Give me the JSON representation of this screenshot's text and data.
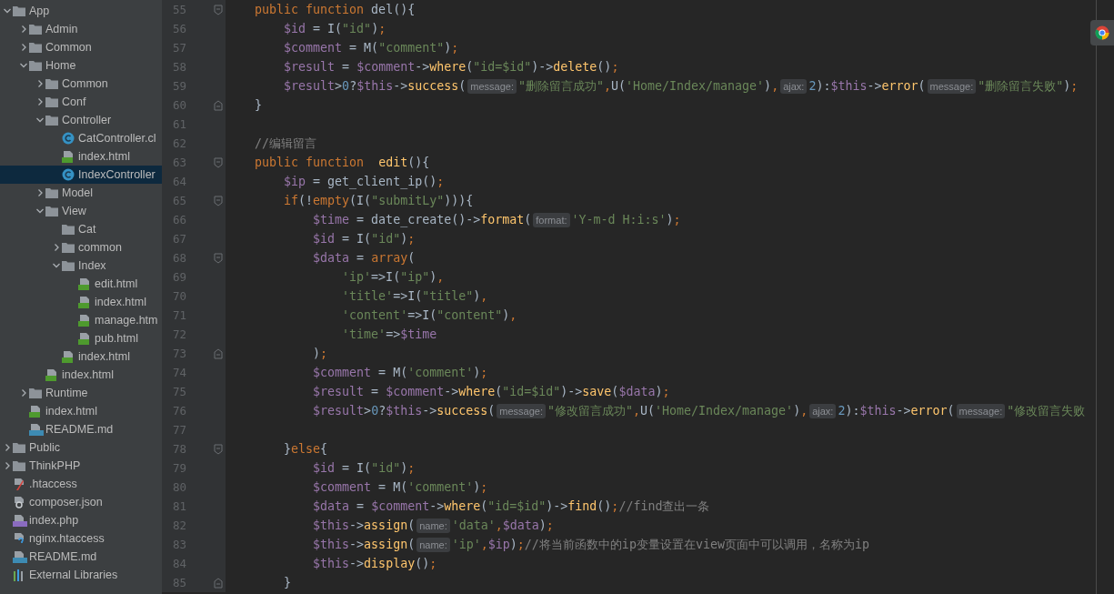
{
  "project_tree": {
    "items": [
      {
        "name": "App",
        "kind": "folder",
        "expanded": true,
        "selected": false,
        "children": [
          {
            "name": "Admin",
            "kind": "folder",
            "expanded": false,
            "selected": false
          },
          {
            "name": "Common",
            "kind": "folder",
            "expanded": false,
            "selected": false
          },
          {
            "name": "Home",
            "kind": "folder",
            "expanded": true,
            "selected": false,
            "children": [
              {
                "name": "Common",
                "kind": "folder",
                "expanded": false,
                "selected": false
              },
              {
                "name": "Conf",
                "kind": "folder",
                "expanded": false,
                "selected": false
              },
              {
                "name": "Controller",
                "kind": "folder",
                "expanded": true,
                "selected": false,
                "children": [
                  {
                    "name": "CatController.cl",
                    "kind": "class",
                    "selected": false
                  },
                  {
                    "name": "index.html",
                    "kind": "html",
                    "selected": false
                  },
                  {
                    "name": "IndexController",
                    "kind": "class",
                    "selected": true
                  }
                ]
              },
              {
                "name": "Model",
                "kind": "folder",
                "expanded": false,
                "selected": false
              },
              {
                "name": "View",
                "kind": "folder",
                "expanded": true,
                "selected": false,
                "children": [
                  {
                    "name": "Cat",
                    "kind": "folder",
                    "selected": false
                  },
                  {
                    "name": "common",
                    "kind": "folder",
                    "expanded": false,
                    "selected": false
                  },
                  {
                    "name": "Index",
                    "kind": "folder",
                    "expanded": true,
                    "selected": false,
                    "children": [
                      {
                        "name": "edit.html",
                        "kind": "html",
                        "selected": false
                      },
                      {
                        "name": "index.html",
                        "kind": "html",
                        "selected": false
                      },
                      {
                        "name": "manage.htm",
                        "kind": "html",
                        "selected": false
                      },
                      {
                        "name": "pub.html",
                        "kind": "html",
                        "selected": false
                      }
                    ]
                  },
                  {
                    "name": "index.html",
                    "kind": "html",
                    "selected": false
                  }
                ]
              },
              {
                "name": "index.html",
                "kind": "html",
                "selected": false
              }
            ]
          },
          {
            "name": "Runtime",
            "kind": "folder",
            "expanded": false,
            "selected": false
          },
          {
            "name": "index.html",
            "kind": "html",
            "selected": false
          },
          {
            "name": "README.md",
            "kind": "md",
            "selected": false
          }
        ]
      },
      {
        "name": "Public",
        "kind": "folder",
        "expanded": false,
        "selected": false
      },
      {
        "name": "ThinkPHP",
        "kind": "folder",
        "expanded": false,
        "selected": false
      },
      {
        "name": ".htaccess",
        "kind": "htaccess",
        "selected": false
      },
      {
        "name": "composer.json",
        "kind": "json",
        "selected": false
      },
      {
        "name": "index.php",
        "kind": "php",
        "selected": false
      },
      {
        "name": "nginx.htaccess",
        "kind": "nginx",
        "selected": false
      },
      {
        "name": "README.md",
        "kind": "md",
        "selected": false
      },
      {
        "name": "External Libraries",
        "kind": "libraries",
        "selected": false
      }
    ]
  },
  "editor": {
    "lines": [
      {
        "number": "55",
        "fold_start": true,
        "tokens": [
          {
            "kind": "keyword",
            "text": "    public function"
          },
          {
            "kind": "plain",
            "text": " del(){"
          }
        ]
      },
      {
        "number": "56",
        "tokens": [
          {
            "kind": "variable",
            "text": "        $id"
          },
          {
            "kind": "plain",
            "text": " = I("
          },
          {
            "kind": "string",
            "text": "\"id\""
          },
          {
            "kind": "plain",
            "text": ")"
          },
          {
            "kind": "punct",
            "text": ";"
          }
        ]
      },
      {
        "number": "57",
        "tokens": [
          {
            "kind": "variable",
            "text": "        $comment"
          },
          {
            "kind": "plain",
            "text": " = M("
          },
          {
            "kind": "string",
            "text": "\"comment\""
          },
          {
            "kind": "plain",
            "text": ")"
          },
          {
            "kind": "punct",
            "text": ";"
          }
        ]
      },
      {
        "number": "58",
        "tokens": [
          {
            "kind": "variable",
            "text": "        $result"
          },
          {
            "kind": "plain",
            "text": " = "
          },
          {
            "kind": "variable",
            "text": "$comment"
          },
          {
            "kind": "plain",
            "text": "->"
          },
          {
            "kind": "method",
            "text": "where"
          },
          {
            "kind": "plain",
            "text": "("
          },
          {
            "kind": "string",
            "text": "\"id=$id\""
          },
          {
            "kind": "plain",
            "text": ")->"
          },
          {
            "kind": "method",
            "text": "delete"
          },
          {
            "kind": "plain",
            "text": "()"
          },
          {
            "kind": "punct",
            "text": ";"
          }
        ]
      },
      {
        "number": "59",
        "tokens": [
          {
            "kind": "variable",
            "text": "        $result"
          },
          {
            "kind": "plain",
            "text": ">"
          },
          {
            "kind": "number",
            "text": "0"
          },
          {
            "kind": "plain",
            "text": "?"
          },
          {
            "kind": "variable",
            "text": "$this"
          },
          {
            "kind": "plain",
            "text": "->"
          },
          {
            "kind": "method",
            "text": "success"
          },
          {
            "kind": "plain",
            "text": "("
          },
          {
            "kind": "hint",
            "text": "message:"
          },
          {
            "kind": "string",
            "text": "\"删除留言成功\""
          },
          {
            "kind": "punct",
            "text": ","
          },
          {
            "kind": "plain",
            "text": "U("
          },
          {
            "kind": "string",
            "text": "'Home/Index/manage'"
          },
          {
            "kind": "plain",
            "text": ")"
          },
          {
            "kind": "punct",
            "text": ","
          },
          {
            "kind": "hint",
            "text": "ajax:"
          },
          {
            "kind": "number",
            "text": "2"
          },
          {
            "kind": "plain",
            "text": "):"
          },
          {
            "kind": "variable",
            "text": "$this"
          },
          {
            "kind": "plain",
            "text": "->"
          },
          {
            "kind": "method",
            "text": "error"
          },
          {
            "kind": "plain",
            "text": "("
          },
          {
            "kind": "hint",
            "text": "message:"
          },
          {
            "kind": "string",
            "text": "\"删除留言失败\""
          },
          {
            "kind": "plain",
            "text": ")"
          },
          {
            "kind": "punct",
            "text": ";"
          }
        ]
      },
      {
        "number": "60",
        "fold_end": true,
        "tokens": [
          {
            "kind": "plain",
            "text": "    }"
          }
        ]
      },
      {
        "number": "61"
      },
      {
        "number": "62",
        "tokens": [
          {
            "kind": "comment",
            "text": "    //编辑留言"
          }
        ]
      },
      {
        "number": "63",
        "fold_start": true,
        "tokens": [
          {
            "kind": "keyword",
            "text": "    public function  "
          },
          {
            "kind": "method",
            "text": "edit"
          },
          {
            "kind": "plain",
            "text": "(){"
          }
        ]
      },
      {
        "number": "64",
        "tokens": [
          {
            "kind": "variable",
            "text": "        $ip"
          },
          {
            "kind": "plain",
            "text": " = get_client_ip()"
          },
          {
            "kind": "punct",
            "text": ";"
          }
        ]
      },
      {
        "number": "65",
        "fold_start": true,
        "tokens": [
          {
            "kind": "keyword",
            "text": "        if"
          },
          {
            "kind": "plain",
            "text": "(!"
          },
          {
            "kind": "keyword",
            "text": "empty"
          },
          {
            "kind": "plain",
            "text": "(I("
          },
          {
            "kind": "string",
            "text": "\"submitLy\""
          },
          {
            "kind": "plain",
            "text": "))){"
          }
        ]
      },
      {
        "number": "66",
        "tokens": [
          {
            "kind": "variable",
            "text": "            $time"
          },
          {
            "kind": "plain",
            "text": " = date_create()->"
          },
          {
            "kind": "method",
            "text": "format"
          },
          {
            "kind": "plain",
            "text": "("
          },
          {
            "kind": "hint",
            "text": "format:"
          },
          {
            "kind": "string",
            "text": "'Y-m-d H:i:s'"
          },
          {
            "kind": "plain",
            "text": ")"
          },
          {
            "kind": "punct",
            "text": ";"
          }
        ]
      },
      {
        "number": "67",
        "tokens": [
          {
            "kind": "variable",
            "text": "            $id"
          },
          {
            "kind": "plain",
            "text": " = I("
          },
          {
            "kind": "string",
            "text": "\"id\""
          },
          {
            "kind": "plain",
            "text": ")"
          },
          {
            "kind": "punct",
            "text": ";"
          }
        ]
      },
      {
        "number": "68",
        "fold_start": true,
        "tokens": [
          {
            "kind": "variable",
            "text": "            $data"
          },
          {
            "kind": "plain",
            "text": " = "
          },
          {
            "kind": "keyword",
            "text": "array"
          },
          {
            "kind": "plain",
            "text": "("
          }
        ]
      },
      {
        "number": "69",
        "tokens": [
          {
            "kind": "string",
            "text": "                'ip'"
          },
          {
            "kind": "plain",
            "text": "=>I("
          },
          {
            "kind": "string",
            "text": "\"ip\""
          },
          {
            "kind": "plain",
            "text": ")"
          },
          {
            "kind": "punct",
            "text": ","
          }
        ]
      },
      {
        "number": "70",
        "tokens": [
          {
            "kind": "string",
            "text": "                'title'"
          },
          {
            "kind": "plain",
            "text": "=>I("
          },
          {
            "kind": "string",
            "text": "\"title\""
          },
          {
            "kind": "plain",
            "text": ")"
          },
          {
            "kind": "punct",
            "text": ","
          }
        ]
      },
      {
        "number": "71",
        "tokens": [
          {
            "kind": "string",
            "text": "                'content'"
          },
          {
            "kind": "plain",
            "text": "=>I("
          },
          {
            "kind": "string",
            "text": "\"content\""
          },
          {
            "kind": "plain",
            "text": ")"
          },
          {
            "kind": "punct",
            "text": ","
          }
        ]
      },
      {
        "number": "72",
        "tokens": [
          {
            "kind": "string",
            "text": "                'time'"
          },
          {
            "kind": "plain",
            "text": "=>"
          },
          {
            "kind": "variable",
            "text": "$time"
          }
        ]
      },
      {
        "number": "73",
        "fold_end": true,
        "tokens": [
          {
            "kind": "plain",
            "text": "            )"
          },
          {
            "kind": "punct",
            "text": ";"
          }
        ]
      },
      {
        "number": "74",
        "tokens": [
          {
            "kind": "variable",
            "text": "            $comment"
          },
          {
            "kind": "plain",
            "text": " = M("
          },
          {
            "kind": "string",
            "text": "'comment'"
          },
          {
            "kind": "plain",
            "text": ")"
          },
          {
            "kind": "punct",
            "text": ";"
          }
        ]
      },
      {
        "number": "75",
        "tokens": [
          {
            "kind": "variable",
            "text": "            $result"
          },
          {
            "kind": "plain",
            "text": " = "
          },
          {
            "kind": "variable",
            "text": "$comment"
          },
          {
            "kind": "plain",
            "text": "->"
          },
          {
            "kind": "method",
            "text": "where"
          },
          {
            "kind": "plain",
            "text": "("
          },
          {
            "kind": "string",
            "text": "\"id=$id\""
          },
          {
            "kind": "plain",
            "text": ")->"
          },
          {
            "kind": "method",
            "text": "save"
          },
          {
            "kind": "plain",
            "text": "("
          },
          {
            "kind": "variable",
            "text": "$data"
          },
          {
            "kind": "plain",
            "text": ")"
          },
          {
            "kind": "punct",
            "text": ";"
          }
        ]
      },
      {
        "number": "76",
        "tokens": [
          {
            "kind": "variable",
            "text": "            $result"
          },
          {
            "kind": "plain",
            "text": ">"
          },
          {
            "kind": "number",
            "text": "0"
          },
          {
            "kind": "plain",
            "text": "?"
          },
          {
            "kind": "variable",
            "text": "$this"
          },
          {
            "kind": "plain",
            "text": "->"
          },
          {
            "kind": "method",
            "text": "success"
          },
          {
            "kind": "plain",
            "text": "("
          },
          {
            "kind": "hint",
            "text": "message:"
          },
          {
            "kind": "string",
            "text": "\"修改留言成功\""
          },
          {
            "kind": "punct",
            "text": ","
          },
          {
            "kind": "plain",
            "text": "U("
          },
          {
            "kind": "string",
            "text": "'Home/Index/manage'"
          },
          {
            "kind": "plain",
            "text": ")"
          },
          {
            "kind": "punct",
            "text": ","
          },
          {
            "kind": "hint",
            "text": "ajax:"
          },
          {
            "kind": "number",
            "text": "2"
          },
          {
            "kind": "plain",
            "text": "):"
          },
          {
            "kind": "variable",
            "text": "$this"
          },
          {
            "kind": "plain",
            "text": "->"
          },
          {
            "kind": "method",
            "text": "error"
          },
          {
            "kind": "plain",
            "text": "("
          },
          {
            "kind": "hint",
            "text": "message:"
          },
          {
            "kind": "string",
            "text": "\"修改留言失败"
          }
        ]
      },
      {
        "number": "77"
      },
      {
        "number": "78",
        "fold_start": true,
        "tokens": [
          {
            "kind": "plain",
            "text": "        }"
          },
          {
            "kind": "keyword",
            "text": "else"
          },
          {
            "kind": "plain",
            "text": "{"
          }
        ]
      },
      {
        "number": "79",
        "tokens": [
          {
            "kind": "variable",
            "text": "            $id"
          },
          {
            "kind": "plain",
            "text": " = I("
          },
          {
            "kind": "string",
            "text": "\"id\""
          },
          {
            "kind": "plain",
            "text": ")"
          },
          {
            "kind": "punct",
            "text": ";"
          }
        ]
      },
      {
        "number": "80",
        "tokens": [
          {
            "kind": "variable",
            "text": "            $comment"
          },
          {
            "kind": "plain",
            "text": " = M("
          },
          {
            "kind": "string",
            "text": "'comment'"
          },
          {
            "kind": "plain",
            "text": ")"
          },
          {
            "kind": "punct",
            "text": ";"
          }
        ]
      },
      {
        "number": "81",
        "tokens": [
          {
            "kind": "variable",
            "text": "            $data"
          },
          {
            "kind": "plain",
            "text": " = "
          },
          {
            "kind": "variable",
            "text": "$comment"
          },
          {
            "kind": "plain",
            "text": "->"
          },
          {
            "kind": "method",
            "text": "where"
          },
          {
            "kind": "plain",
            "text": "("
          },
          {
            "kind": "string",
            "text": "\"id=$id\""
          },
          {
            "kind": "plain",
            "text": ")->"
          },
          {
            "kind": "method",
            "text": "find"
          },
          {
            "kind": "plain",
            "text": "()"
          },
          {
            "kind": "punct",
            "text": ";"
          },
          {
            "kind": "comment",
            "text": "//find查出一条"
          }
        ]
      },
      {
        "number": "82",
        "tokens": [
          {
            "kind": "variable",
            "text": "            $this"
          },
          {
            "kind": "plain",
            "text": "->"
          },
          {
            "kind": "method",
            "text": "assign"
          },
          {
            "kind": "plain",
            "text": "("
          },
          {
            "kind": "hint",
            "text": "name:"
          },
          {
            "kind": "string",
            "text": "'data'"
          },
          {
            "kind": "punct",
            "text": ","
          },
          {
            "kind": "variable",
            "text": "$data"
          },
          {
            "kind": "plain",
            "text": ")"
          },
          {
            "kind": "punct",
            "text": ";"
          }
        ]
      },
      {
        "number": "83",
        "tokens": [
          {
            "kind": "variable",
            "text": "            $this"
          },
          {
            "kind": "plain",
            "text": "->"
          },
          {
            "kind": "method",
            "text": "assign"
          },
          {
            "kind": "plain",
            "text": "("
          },
          {
            "kind": "hint",
            "text": "name:"
          },
          {
            "kind": "string",
            "text": "'ip'"
          },
          {
            "kind": "punct",
            "text": ","
          },
          {
            "kind": "variable",
            "text": "$ip"
          },
          {
            "kind": "plain",
            "text": ")"
          },
          {
            "kind": "punct",
            "text": ";"
          },
          {
            "kind": "comment",
            "text": "//将当前函数中的ip变量设置在view页面中可以调用，名称为ip"
          }
        ]
      },
      {
        "number": "84",
        "tokens": [
          {
            "kind": "variable",
            "text": "            $this"
          },
          {
            "kind": "plain",
            "text": "->"
          },
          {
            "kind": "method",
            "text": "display"
          },
          {
            "kind": "plain",
            "text": "()"
          },
          {
            "kind": "punct",
            "text": ";"
          }
        ]
      },
      {
        "number": "85",
        "fold_end": true,
        "tokens": [
          {
            "kind": "plain",
            "text": "        }"
          }
        ]
      }
    ]
  }
}
